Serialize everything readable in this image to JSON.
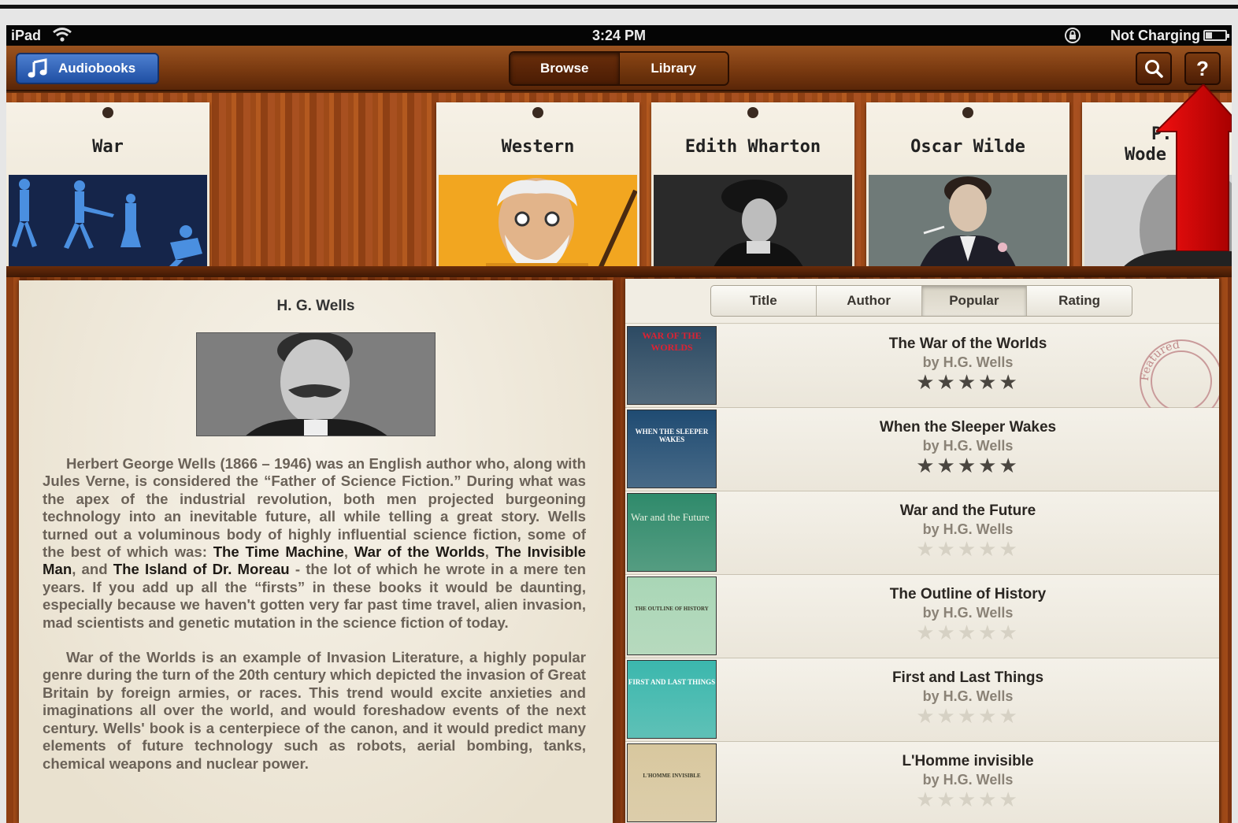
{
  "status_bar": {
    "device": "iPad",
    "time": "3:24 PM",
    "charging": "Not Charging"
  },
  "toolbar": {
    "audiobooks_label": "Audiobooks",
    "segments": [
      "Browse",
      "Library"
    ],
    "selected_segment": "Browse",
    "search_icon": "search-icon",
    "help_label": "?"
  },
  "shelf": {
    "cards": [
      {
        "label": "War"
      },
      {
        "label": "Western"
      },
      {
        "label": "Edith Wharton"
      },
      {
        "label": "Oscar Wilde"
      },
      {
        "label": "P. G. Wodehouse",
        "visible_text": "P.\nWode"
      }
    ]
  },
  "author": {
    "name": "H. G. Wells",
    "bio_p1_a": "Herbert George Wells (1866 – 1946) was an English author who, along with Jules Verne, is considered the “Father of Science Fiction.” During what was the apex of the industrial revolution, both men projected burgeoning technology into an inevitable future, all while telling a great story. Wells turned out a voluminous body of highly influential science fiction, some of the best of which was: ",
    "bio_b1": "The Time Machine",
    "bio_sep1": ", ",
    "bio_b2": "War of the Worlds",
    "bio_sep2": ", ",
    "bio_b3": "The Invisible Man",
    "bio_sep3": ", and ",
    "bio_b4": "The Island of Dr. Moreau",
    "bio_p1_b": " - the lot of which he wrote in a mere ten years. If you add up all the “firsts” in these books it would be daunting, especially because we haven't gotten very far past time travel, alien invasion, mad scientists and genetic mutation in the science fiction of today.",
    "bio_p2": "War of the Worlds is an example of Invasion Literature, a highly popular genre during the turn of the 20th century which depicted the invasion of Great Britain by foreign armies, or races. This trend would excite anxieties and imaginations all over the world, and would foreshadow events of the next century. Wells' book is a centerpiece of the canon, and it would predict many elements of future technology such as robots, aerial bombing, tanks, chemical weapons and nuclear power."
  },
  "sort_tabs": {
    "items": [
      "Title",
      "Author",
      "Popular",
      "Rating"
    ],
    "selected": "Popular"
  },
  "books": [
    {
      "title": "The War of the Worlds",
      "author": "by H.G. Wells",
      "rating": 5,
      "featured": true,
      "cover_text": "WAR OF THE WORLDS",
      "cover_color": "#2c4a63"
    },
    {
      "title": "When the Sleeper Wakes",
      "author": "by H.G. Wells",
      "rating": 5,
      "featured": false,
      "cover_text": "WHEN THE SLEEPER WAKES",
      "cover_color": "#1f4b72"
    },
    {
      "title": "War and the Future",
      "author": "by H.G. Wells",
      "rating": 0,
      "featured": false,
      "cover_text": "War and the Future",
      "cover_color": "#2f8a6b"
    },
    {
      "title": "The Outline of History",
      "author": "by H.G. Wells",
      "rating": 0,
      "featured": false,
      "cover_text": "THE OUTLINE OF HISTORY",
      "cover_color": "#a9d6b6"
    },
    {
      "title": "First and Last Things",
      "author": "by H.G. Wells",
      "rating": 0,
      "featured": false,
      "cover_text": "FIRST AND LAST THINGS",
      "cover_color": "#3bb7ad"
    },
    {
      "title": "L'Homme invisible",
      "author": "by H.G. Wells",
      "rating": 0,
      "featured": false,
      "cover_text": "L'HOMME INVISIBLE",
      "cover_color": "#d8c79e"
    }
  ],
  "stamp_text": "Featured",
  "colors": {
    "accent_blue": "#2f63b8",
    "wood": "#9e4a18",
    "paper": "#f1ede3",
    "arrow": "#d40000"
  }
}
